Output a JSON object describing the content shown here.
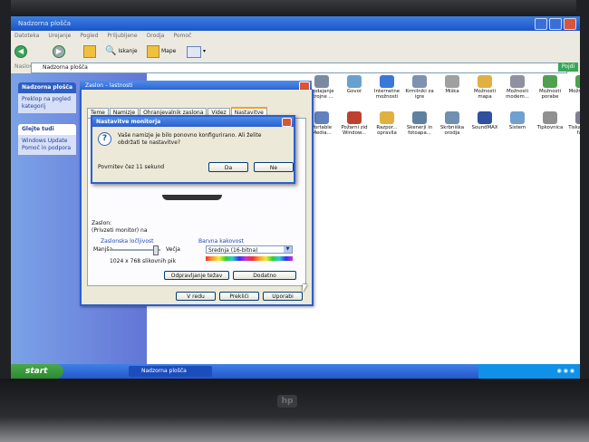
{
  "explorer": {
    "title": "Nadzorna plošča",
    "menu": [
      "Datoteka",
      "Urejanje",
      "Pogled",
      "Priljubljene",
      "Orodja",
      "Pomoč"
    ],
    "toolbar": {
      "search": "Iskanje",
      "folders": "Mape"
    },
    "address_label": "Naslov",
    "address_value": "Nadzorna plošča",
    "go": "Pojdi"
  },
  "left_pane": {
    "panel_title": "Nadzorna plošča",
    "panel_link": "Preklop na pogled kategorij",
    "see_also": "Glejte tudi",
    "see_also_items": [
      "Windows Update",
      "Pomoč in podpora"
    ]
  },
  "icons": [
    {
      "label": "Dodajanje strojne ...",
      "color": "#7a8aa0"
    },
    {
      "label": "Govor",
      "color": "#6aa0d0"
    },
    {
      "label": "Internetne možnosti",
      "color": "#3a78d8"
    },
    {
      "label": "Krmilniki za igre",
      "color": "#8090b0"
    },
    {
      "label": "Miška",
      "color": "#a0a0a0"
    },
    {
      "label": "Možnosti mapa",
      "color": "#e0b040"
    },
    {
      "label": "Možnosti modem...",
      "color": "#9090a0"
    },
    {
      "label": "Možnosti porabe",
      "color": "#50a050"
    },
    {
      "label": "Možnosti ...",
      "color": "#50a050"
    },
    {
      "label": "Portable Media...",
      "color": "#6080c0"
    },
    {
      "label": "Požarni zid Window...",
      "color": "#c04030"
    },
    {
      "label": "Razpor... opravila",
      "color": "#e0b040"
    },
    {
      "label": "Skenerji in fotoapa...",
      "color": "#6080a0"
    },
    {
      "label": "Skrbniška orodja",
      "color": "#7090b0"
    },
    {
      "label": "SoundMAX",
      "color": "#3050a0"
    },
    {
      "label": "Sistem",
      "color": "#70a0d0"
    },
    {
      "label": "Tipkovnica",
      "color": "#909090"
    },
    {
      "label": "Tiskalniki in faksi",
      "color": "#808090"
    }
  ],
  "display_dialog": {
    "title": "Zaslon – lastnosti",
    "tabs": [
      "Teme",
      "Namizje",
      "Ohranjevalnik zaslona",
      "Videz",
      "Nastavitve"
    ],
    "active_tab": "Nastavitve",
    "display_label": "Zaslon:",
    "display_value": "(Privzeti monitor) na",
    "resolution_group": "Zaslonska ločljivost",
    "less": "Manjša",
    "more": "Večja",
    "resolution_value": "1024 x 768 slikovnih pik",
    "color_group": "Barvna kakovost",
    "color_value": "Srednja (16-bitna)",
    "troubleshoot": "Odpravljanje težav",
    "advanced": "Dodatno",
    "ok": "V redu",
    "cancel": "Prekliči",
    "apply": "Uporabi"
  },
  "monitor_dialog": {
    "title": "Nastavitve monitorja",
    "message_line1": "Vaše namizje je bilo ponovno konfigurirano.  Ali želite",
    "message_line2": "obdržati te nastavitve?",
    "countdown": "Povrnitev čez  11 sekund",
    "yes": "Da",
    "no": "Ne"
  },
  "taskbar": {
    "start": "start",
    "task": "Nadzorna plošča"
  }
}
